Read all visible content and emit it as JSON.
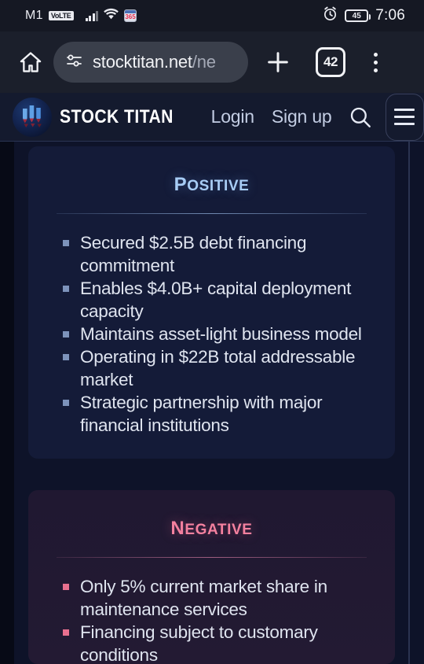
{
  "statusbar": {
    "carrier": "M1",
    "volte_badge": "VoLTE",
    "app_badge": "365",
    "battery_level": "45",
    "time": "7:06",
    "icons": [
      "signal-bars-icon",
      "wifi-icon",
      "calendar-app-icon",
      "alarm-clock-icon",
      "battery-icon"
    ]
  },
  "browser": {
    "home_icon": "home-icon",
    "site_settings_icon": "tune-sliders-icon",
    "url_visible": "stocktitan.net",
    "url_dim": "/ne",
    "new_tab_icon": "plus-icon",
    "tab_count": "42",
    "overflow_icon": "more-vertical-icon"
  },
  "site": {
    "brand": "STOCK TITAN",
    "logo_icon": "stock-titan-logo-icon",
    "login_label": "Login",
    "signup_label": "Sign up",
    "search_icon": "search-icon",
    "menu_icon": "hamburger-menu-icon"
  },
  "cards": [
    {
      "id": "positive",
      "title": "Positive",
      "accent": "#a8cdf5",
      "bullet_color": "#7d93bb",
      "background": "#141b38",
      "items": [
        "Secured $2.5B debt financing commitment",
        "Enables $4.0B+ capital deployment capacity",
        "Maintains asset-light business model",
        "Operating in $22B total addressable market",
        "Strategic partnership with major financial institutions"
      ]
    },
    {
      "id": "negative",
      "title": "Negative",
      "accent": "#f4819f",
      "bullet_color": "#e8708f",
      "background": "#201831",
      "items": [
        "Only 5% current market share in maintenance services",
        "Financing subject to customary conditions"
      ]
    }
  ]
}
